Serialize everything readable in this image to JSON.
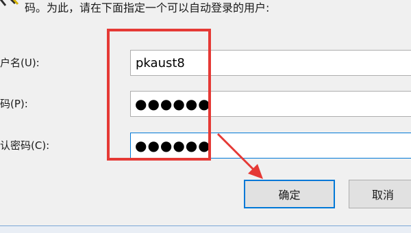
{
  "dialog": {
    "intro": "码。为此，请在下面指定一个可以自动登录的用户:",
    "fields": {
      "username": {
        "label": "户名(U):",
        "value": "pkaust8"
      },
      "password": {
        "label": "码(P):",
        "masked_value": "●●●●●●"
      },
      "confirm": {
        "label": "认密码(C):",
        "masked_value": "●●●●●●"
      }
    },
    "buttons": {
      "ok": "确定",
      "cancel": "取消"
    }
  },
  "colors": {
    "annotation_red": "#e53935",
    "focus_blue": "#0078d7"
  },
  "icons": [
    "key-icon"
  ]
}
